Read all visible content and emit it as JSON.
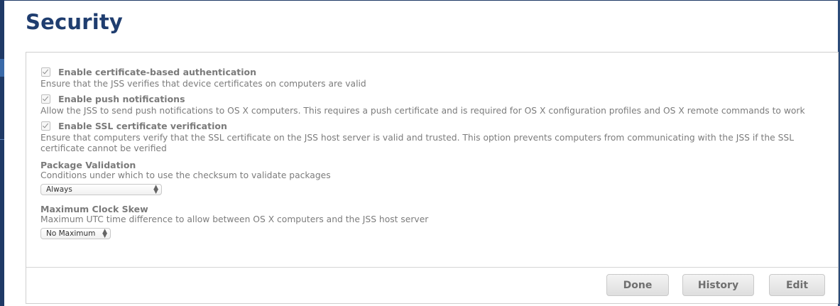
{
  "page": {
    "title": "Security"
  },
  "settings": {
    "cert_auth": {
      "label": "Enable certificate-based authentication",
      "description": "Ensure that the JSS verifies that device certificates on computers are valid",
      "checked": true
    },
    "push": {
      "label": "Enable push notifications",
      "description": "Allow the JSS to send push notifications to OS X computers. This requires a push certificate and is required for OS X configuration profiles and OS X remote commands to work",
      "checked": true
    },
    "ssl": {
      "label": "Enable SSL certificate verification",
      "description": "Ensure that computers verify that the SSL certificate on the JSS host server is valid and trusted. This option prevents computers from communicating with the JSS if the SSL certificate cannot be verified",
      "checked": true
    },
    "package_validation": {
      "label": "Package Validation",
      "description": "Conditions under which to use the checksum to validate packages",
      "selected": "Always"
    },
    "clock_skew": {
      "label": "Maximum Clock Skew",
      "description": "Maximum UTC time difference to allow between OS X computers and the JSS host server",
      "selected": "No Maximum"
    }
  },
  "buttons": {
    "done": "Done",
    "history": "History",
    "edit": "Edit"
  },
  "icons": {
    "checkbox": "checkmark-icon",
    "select_arrows": "up-down-arrows-icon"
  },
  "colors": {
    "title": "#1f3d6f",
    "sidebar": "#1f3a66"
  }
}
